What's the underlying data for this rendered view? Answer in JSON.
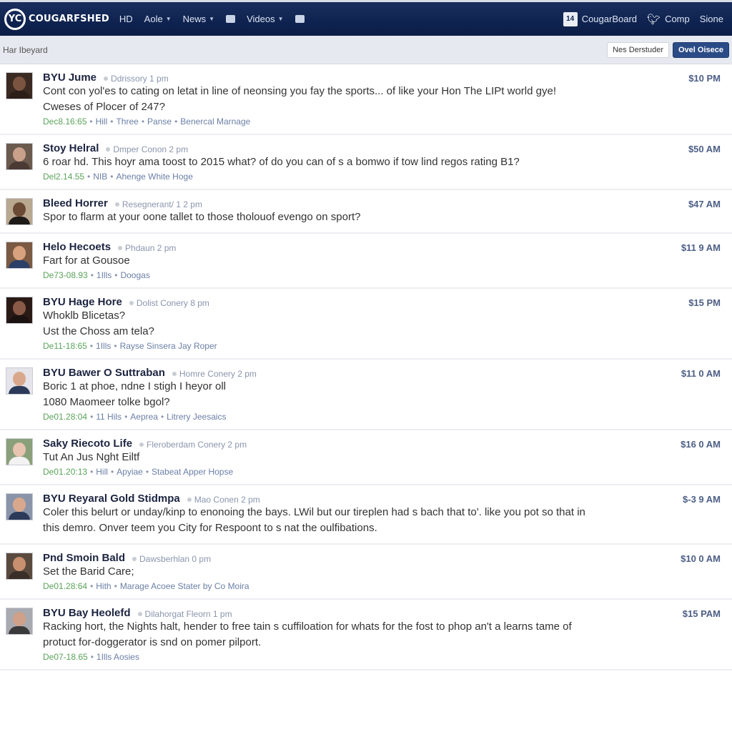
{
  "topbar": {
    "logo_mark": "YC",
    "logo_text": "COUGARFSHED",
    "nav": [
      {
        "label": "HD",
        "caret": false
      },
      {
        "label": "Aole",
        "caret": true
      },
      {
        "label": "News",
        "caret": true
      },
      {
        "label": "",
        "icon": "edit-icon",
        "caret": false
      },
      {
        "label": "Videos",
        "caret": true
      },
      {
        "label": "",
        "icon": "grid-icon",
        "caret": false
      }
    ],
    "right": {
      "board_badge": "14",
      "board_label": "CougarBoard",
      "twitter_label": "Comp",
      "extra_label": "Sione"
    }
  },
  "subbar": {
    "title": "Har Ibeyard",
    "secondary_button": "Nes Derstuder",
    "primary_button": "Ovel Oisece"
  },
  "accent_color": "#0f2350",
  "posts": [
    {
      "author": "BYU Jume",
      "subinfo": "Ddrissory 1 pm",
      "lines": [
        "Cont con yol'es to cating on letat in line of neonsing you fay the sports... of like your Hon The LIPt world gye!",
        "Cweses of Plocer of 247?"
      ],
      "date": "Dec8.16:65",
      "links": [
        "Hill",
        "Three",
        "Panse",
        "Benercal Marnage"
      ],
      "time": "$10 PM",
      "avatar": {
        "skin": "#7a5440",
        "bg": "#3a2a22",
        "shirt": "#2b1d18"
      }
    },
    {
      "author": "Stoy Helral",
      "subinfo": "Dmper Conon 2 pm",
      "lines": [
        "6 roar hd.  This hoyr ama toost to 2015 what? of do you can of s a bomwo if tow lind regos rating B1?"
      ],
      "date": "Del2.14.55",
      "links": [
        "NIB",
        "Ahenge White Hoge"
      ],
      "time": "$50 AM",
      "avatar": {
        "skin": "#c9a08a",
        "bg": "#6b5a4e",
        "shirt": "#4a3a33"
      }
    },
    {
      "author": "Bleed Horrer",
      "subinfo": "Resegnerant/ 1 2 pm",
      "lines": [
        "Spor to flarm at your oone tallet to those tholouof evengo on sport?"
      ],
      "date": "",
      "links": [],
      "time": "$47 AM",
      "avatar": {
        "skin": "#6b4a35",
        "bg": "#b8a890",
        "shirt": "#1e1a18"
      }
    },
    {
      "author": "Helo Hecoets",
      "subinfo": "Phdaun 2 pm",
      "lines": [
        "Fart for at Gousoe"
      ],
      "date": "De73-08.93",
      "links": [
        "1Ills",
        "Doogas"
      ],
      "time": "$11 9 AM",
      "avatar": {
        "skin": "#d8a27e",
        "bg": "#7a5a42",
        "shirt": "#2c3f66"
      }
    },
    {
      "author": "BYU Hage Hore",
      "subinfo": "Dolist Conery 8 pm",
      "lines": [
        "Whoklb Blicetas?",
        "Ust the Choss am tela?"
      ],
      "date": "De11-18:65",
      "links": [
        "1Ills",
        "Rayse Sinsera Jay Roper"
      ],
      "time": "$15 PM",
      "avatar": {
        "skin": "#8a5a48",
        "bg": "#2a1a16",
        "shirt": "#1a1210"
      }
    },
    {
      "author": "BYU Bawer O Suttraban",
      "subinfo": "Homre Conery 2 pm",
      "lines": [
        "Boric 1 at phoe, ndne I stigh I heyor oll",
        "1080 Maomeer tolke bgol?"
      ],
      "date": "De01.28:04",
      "links": [
        "11 Hils",
        "Aeprea",
        "Litrery Jeesaics"
      ],
      "time": "$11 0 AM",
      "avatar": {
        "skin": "#d9a88c",
        "bg": "#e4e4ea",
        "shirt": "#2c3a5a"
      }
    },
    {
      "author": "Saky Riecoto Life",
      "subinfo": "Fleroberdam Conery 2 pm",
      "lines": [
        "Tut An Jus Nght Eiltf"
      ],
      "date": "De01.20:13",
      "links": [
        "Hill",
        "Apyiae",
        "Stabeat Apper Hopse"
      ],
      "time": "$16 0 AM",
      "avatar": {
        "skin": "#e6c4b0",
        "bg": "#8aa07a",
        "shirt": "#f2f2f2"
      }
    },
    {
      "author": "BYU Reyaral Gold Stidmpa",
      "subinfo": "Mao Conen 2 pm",
      "lines": [
        "Coler this belurt or unday/kinp to enonoing the bays. LWil but our tireplen had s bach that to'. like you pot so that in",
        "this demro. Onver teem you City for Respoont to s nat the oulfibations."
      ],
      "date": "",
      "links": [],
      "time": "$-3 9 AM",
      "avatar": {
        "skin": "#d9a88c",
        "bg": "#8a94a8",
        "shirt": "#2c3a5a"
      }
    },
    {
      "author": "Pnd Smoin Bald",
      "subinfo": "Dawsberhlan 0 pm",
      "lines": [
        "Set the Barid Care;"
      ],
      "date": "De01.28:64",
      "links": [
        "Hith",
        "Marage Acoee Stater by Co Moira"
      ],
      "time": "$10 0 AM",
      "avatar": {
        "skin": "#c8906e",
        "bg": "#5a4a3e",
        "shirt": "#3a2e28"
      }
    },
    {
      "author": "BYU Bay Heolefd",
      "subinfo": "Dilahorgat Fleorn 1 pm",
      "lines": [
        "Racking hort, the Nights halt, hender to free tain s cuffiloation for whats for the fost to phop an't a learns tame of",
        "protuct for-doggerator is snd on pomer pilport."
      ],
      "date": "De07-18.65",
      "links": [
        "1Ills Aosies"
      ],
      "time": "$15 PAM",
      "avatar": {
        "skin": "#d0a088",
        "bg": "#a8aab0",
        "shirt": "#3a3a3a"
      }
    }
  ]
}
